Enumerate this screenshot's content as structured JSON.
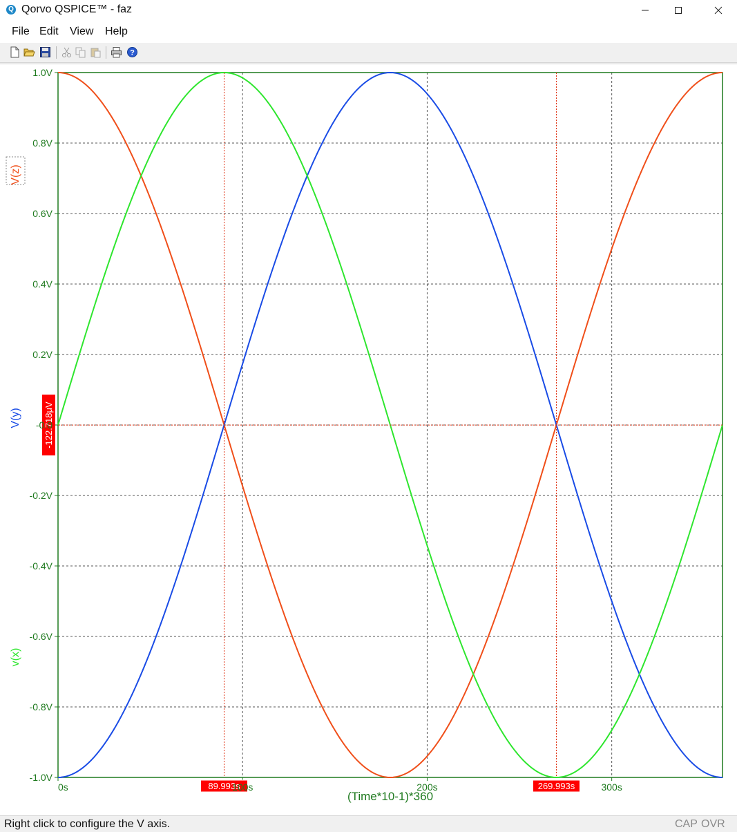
{
  "window": {
    "title": "Qorvo QSPICE™ - faz",
    "app_icon": "qspice-logo-icon",
    "controls": [
      "minimize-icon",
      "maximize-icon",
      "close-icon"
    ]
  },
  "menu": [
    "File",
    "Edit",
    "View",
    "Help"
  ],
  "toolbar": [
    "new-file-icon",
    "open-folder-icon",
    "save-icon",
    "cut-icon",
    "copy-icon",
    "paste-icon",
    "print-icon",
    "help-icon"
  ],
  "status": {
    "message": "Right click to configure the V axis.",
    "cap": "CAP",
    "ovr": "OVR"
  },
  "chart_data": {
    "type": "line",
    "xlabel": "(Time*10-1)*360",
    "xlim": [
      0,
      360
    ],
    "ylim": [
      -1.0,
      1.0
    ],
    "x_ticks": [
      0,
      100,
      200,
      300
    ],
    "x_tick_labels": [
      "0s",
      "100s",
      "200s",
      "300s"
    ],
    "y_ticks": [
      1.0,
      0.8,
      0.6,
      0.4,
      0.2,
      0.0,
      -0.2,
      -0.4,
      -0.6,
      -0.8,
      -1.0
    ],
    "y_tick_labels": [
      "1.0V",
      "0.8V",
      "0.6V",
      "0.4V",
      "0.2V",
      "-0.0",
      "-0.2V",
      "-0.4V",
      "-0.6V",
      "-0.8V",
      "-1.0V"
    ],
    "grid": true,
    "series": [
      {
        "name": "V(z)",
        "color": "#f04f1a",
        "x": [
          0,
          90,
          180,
          270,
          360
        ],
        "y": [
          1.0,
          0.0,
          -1.0,
          0.0,
          1.0
        ]
      },
      {
        "name": "V(y)",
        "color": "#1a4ce6",
        "x": [
          0,
          90,
          180,
          270,
          360
        ],
        "y": [
          -1.0,
          0.0,
          1.0,
          0.0,
          -1.0
        ]
      },
      {
        "name": "v(x)",
        "color": "#2ee62e",
        "x": [
          0,
          90,
          180,
          270,
          360
        ],
        "y": [
          0.0,
          1.0,
          0.0,
          -1.0,
          0.0
        ]
      }
    ],
    "cursors": {
      "x": [
        {
          "value": 89.993,
          "label": "89.993s"
        },
        {
          "value": 269.993,
          "label": "269.993s"
        }
      ],
      "y": {
        "value": -0.000122718,
        "label": "-122.718μV"
      }
    },
    "colors": {
      "axis": "#1f7a1f",
      "grid": "#555555",
      "cursor": "#e03010",
      "cursor_label_bg": "#ff0000"
    }
  }
}
